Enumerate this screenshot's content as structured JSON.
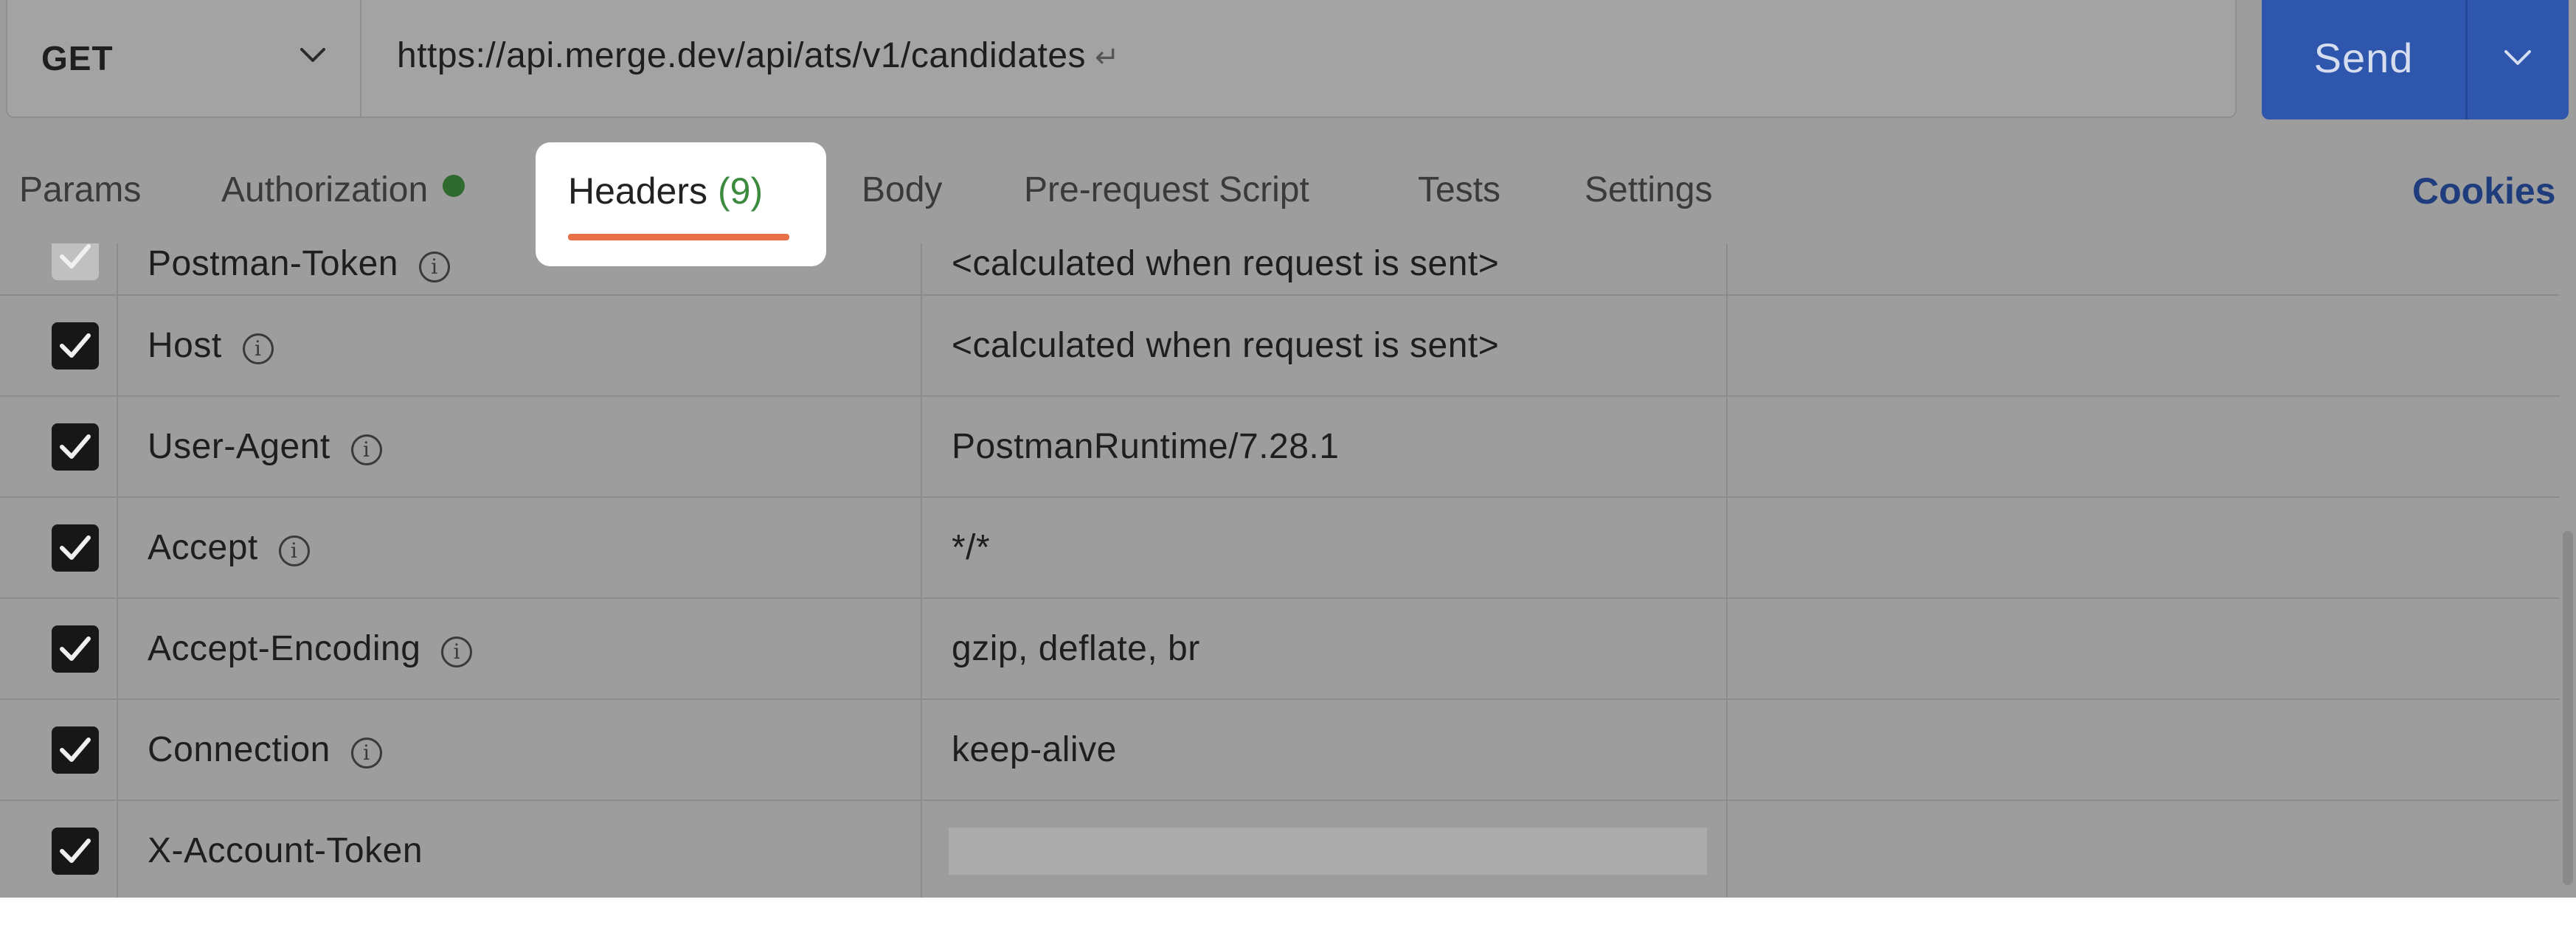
{
  "request": {
    "method": "GET",
    "url": "https://api.merge.dev/api/ats/v1/candidates",
    "url_return_glyph": "↵",
    "send_label": "Send"
  },
  "tabs": {
    "params": "Params",
    "authorization": "Authorization",
    "headers": "Headers",
    "headers_count": "(9)",
    "body": "Body",
    "pre_request_script": "Pre-request Script",
    "tests": "Tests",
    "settings": "Settings",
    "cookies": "Cookies"
  },
  "headers_table": {
    "rows": [
      {
        "key": "Postman-Token",
        "value": "<calculated when request is sent>",
        "checked": true,
        "info": true
      },
      {
        "key": "Host",
        "value": "<calculated when request is sent>",
        "checked": true,
        "info": true
      },
      {
        "key": "User-Agent",
        "value": "PostmanRuntime/7.28.1",
        "checked": true,
        "info": true
      },
      {
        "key": "Accept",
        "value": "*/*",
        "checked": true,
        "info": true
      },
      {
        "key": "Accept-Encoding",
        "value": "gzip, deflate, br",
        "checked": true,
        "info": true
      },
      {
        "key": "Connection",
        "value": "keep-alive",
        "checked": true,
        "info": true
      },
      {
        "key": "X-Account-Token",
        "value": "",
        "checked": true,
        "info": false,
        "redacted": true
      }
    ]
  },
  "icons": {
    "method_chevron": "chevron-down-icon",
    "send_chevron": "chevron-down-icon",
    "info": "info-icon",
    "checkbox": "checkmark-icon"
  },
  "colors": {
    "send_button": "#2e56ad",
    "active_tab_underline": "#e87048",
    "auth_status_dot": "#2f6b2f",
    "headers_count": "#3b8a3e",
    "cookies_link": "#1f3c7d"
  }
}
